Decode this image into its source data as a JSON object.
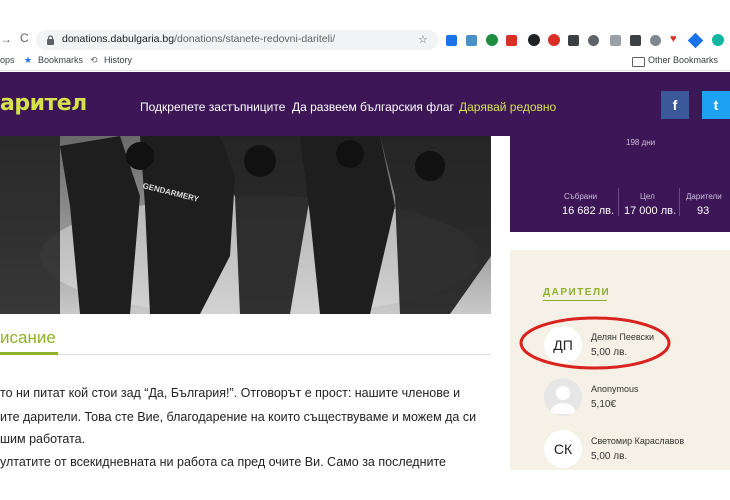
{
  "browser": {
    "url_domain": "donations.dabulgaria.bg",
    "url_path": "/donations/stanete-redovni-dariteli/",
    "bookmarks": {
      "apps": "ops",
      "bookmarks": "Bookmarks",
      "history": "History",
      "other": "Other Bookmarks"
    }
  },
  "site": {
    "logo": "арител",
    "nav": [
      "Подкрепете застъпниците",
      "Да развеем българския флаг",
      "Дарявай редовно"
    ],
    "social": {
      "facebook": "f",
      "twitter": "t"
    }
  },
  "stats": {
    "days": "198 дни",
    "collected_label": "Събрани",
    "collected_value": "16 682 лв.",
    "goal_label": "Цел",
    "goal_value": "17 000 лв.",
    "donors_label": "Дарители",
    "donors_value": "93"
  },
  "donors": {
    "title": "ДАРИТЕЛИ",
    "items": [
      {
        "initials": "ДП",
        "name": "Делян Пеевски",
        "amount": "5,00 лв."
      },
      {
        "initials": "",
        "name": "Anonymous",
        "amount": "5,10€"
      },
      {
        "initials": "СК",
        "name": "Светомир Караславов",
        "amount": "5,00 лв."
      }
    ]
  },
  "description": {
    "heading": "исание",
    "lines": [
      "то ни питат кой стои зад “Да, България!”. Отговорът е прост: нашите членове и",
      "ите дарители. Това сте Вие, благодарение на които съществуваме и можем да си",
      "шим работата.",
      "ултатите от всекидневната ни работа са пред очите Ви. Само за последните"
    ]
  },
  "colors": {
    "header": "#3c1657",
    "accent": "#8fb02a",
    "logo": "#d5e24a",
    "panel": "#f5f1e6",
    "highlight": "#d8231f"
  },
  "image": {
    "photo_caption": "GENDARMERY"
  }
}
